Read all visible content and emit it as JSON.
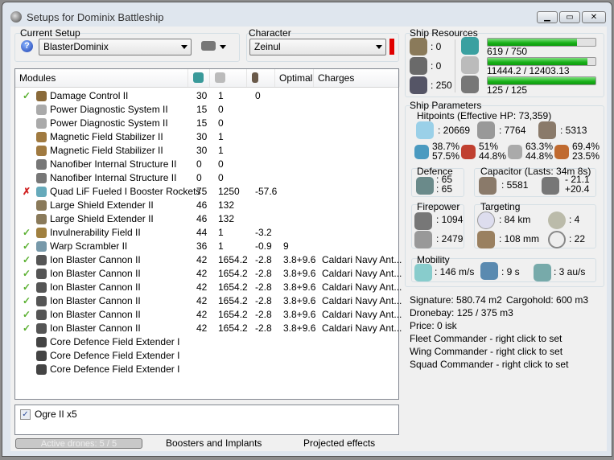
{
  "window": {
    "title": "Setups for Dominix Battleship"
  },
  "setup": {
    "label": "Current Setup",
    "value": "BlasterDominix"
  },
  "character": {
    "label": "Character",
    "value": "Zeinul",
    "status_color": "#e00000"
  },
  "modules": {
    "headers": [
      "Modules",
      "cpu-icon",
      "powergrid-icon",
      "capacitor-icon",
      "Optimal",
      "Charges"
    ],
    "rows": [
      {
        "status": "active",
        "name": "Damage Control II",
        "cpu": "30",
        "pg": "1",
        "cap": "0",
        "optimal": "",
        "charges": ""
      },
      {
        "status": "",
        "name": "Power Diagnostic System II",
        "cpu": "15",
        "pg": "0",
        "cap": "",
        "optimal": "",
        "charges": ""
      },
      {
        "status": "",
        "name": "Power Diagnostic System II",
        "cpu": "15",
        "pg": "0",
        "cap": "",
        "optimal": "",
        "charges": ""
      },
      {
        "status": "",
        "name": "Magnetic Field Stabilizer II",
        "cpu": "30",
        "pg": "1",
        "cap": "",
        "optimal": "",
        "charges": ""
      },
      {
        "status": "",
        "name": "Magnetic Field Stabilizer II",
        "cpu": "30",
        "pg": "1",
        "cap": "",
        "optimal": "",
        "charges": ""
      },
      {
        "status": "",
        "name": "Nanofiber Internal Structure II",
        "cpu": "0",
        "pg": "0",
        "cap": "",
        "optimal": "",
        "charges": ""
      },
      {
        "status": "",
        "name": "Nanofiber Internal Structure II",
        "cpu": "0",
        "pg": "0",
        "cap": "",
        "optimal": "",
        "charges": ""
      },
      {
        "status": "offline",
        "name": "Quad LiF Fueled I Booster Rockets",
        "cpu": "75",
        "pg": "1250",
        "cap": "-57.6",
        "optimal": "",
        "charges": ""
      },
      {
        "status": "",
        "name": "Large Shield Extender II",
        "cpu": "46",
        "pg": "132",
        "cap": "",
        "optimal": "",
        "charges": ""
      },
      {
        "status": "",
        "name": "Large Shield Extender II",
        "cpu": "46",
        "pg": "132",
        "cap": "",
        "optimal": "",
        "charges": ""
      },
      {
        "status": "active",
        "name": "Invulnerability Field II",
        "cpu": "44",
        "pg": "1",
        "cap": "-3.2",
        "optimal": "",
        "charges": ""
      },
      {
        "status": "active",
        "name": "Warp Scrambler II",
        "cpu": "36",
        "pg": "1",
        "cap": "-0.9",
        "optimal": "9",
        "charges": ""
      },
      {
        "status": "active",
        "name": "Ion Blaster Cannon II",
        "cpu": "42",
        "pg": "1654.2",
        "cap": "-2.8",
        "optimal": "3.8+9.6",
        "charges": "Caldari Navy Ant..."
      },
      {
        "status": "active",
        "name": "Ion Blaster Cannon II",
        "cpu": "42",
        "pg": "1654.2",
        "cap": "-2.8",
        "optimal": "3.8+9.6",
        "charges": "Caldari Navy Ant..."
      },
      {
        "status": "active",
        "name": "Ion Blaster Cannon II",
        "cpu": "42",
        "pg": "1654.2",
        "cap": "-2.8",
        "optimal": "3.8+9.6",
        "charges": "Caldari Navy Ant..."
      },
      {
        "status": "active",
        "name": "Ion Blaster Cannon II",
        "cpu": "42",
        "pg": "1654.2",
        "cap": "-2.8",
        "optimal": "3.8+9.6",
        "charges": "Caldari Navy Ant..."
      },
      {
        "status": "active",
        "name": "Ion Blaster Cannon II",
        "cpu": "42",
        "pg": "1654.2",
        "cap": "-2.8",
        "optimal": "3.8+9.6",
        "charges": "Caldari Navy Ant..."
      },
      {
        "status": "active",
        "name": "Ion Blaster Cannon II",
        "cpu": "42",
        "pg": "1654.2",
        "cap": "-2.8",
        "optimal": "3.8+9.6",
        "charges": "Caldari Navy Ant..."
      },
      {
        "status": "",
        "name": "Core Defence Field Extender I",
        "cpu": "",
        "pg": "",
        "cap": "",
        "optimal": "",
        "charges": ""
      },
      {
        "status": "",
        "name": "Core Defence Field Extender I",
        "cpu": "",
        "pg": "",
        "cap": "",
        "optimal": "",
        "charges": ""
      },
      {
        "status": "",
        "name": "Core Defence Field Extender I",
        "cpu": "",
        "pg": "",
        "cap": "",
        "optimal": "",
        "charges": ""
      }
    ]
  },
  "drones": {
    "item": "Ogre II x5",
    "checked": true
  },
  "bottom": {
    "active_drones": "Active drones: 5 / 5",
    "boosters": "Boosters and Implants",
    "projected": "Projected effects"
  },
  "resources": {
    "title": "Ship Resources",
    "turrets": ": 0",
    "launchers": ": 0",
    "drone_bw": ": 250",
    "cpu": {
      "text": "619 / 750",
      "fraction": 0.825
    },
    "pg": {
      "text": "11444.2 / 12403.13",
      "fraction": 0.923
    },
    "drone": {
      "text": "125 / 125",
      "fraction": 1.0
    }
  },
  "params": {
    "title": "Ship Parameters",
    "hp_title": "Hitpoints (Effective HP: 73,359)",
    "shield": ": 20669",
    "armor": ": 7764",
    "structure": ": 5313",
    "resists": [
      [
        "38.7%",
        "57.5%"
      ],
      [
        "51%",
        "44.8%"
      ],
      [
        "63.3%",
        "44.8%"
      ],
      [
        "69.4%",
        "23.5%"
      ]
    ],
    "defence_title": "Defence",
    "defence": [
      ": 65",
      ": 65"
    ],
    "cap_title": "Capacitor (Lasts: 34m 8s)",
    "cap": ": 5581",
    "cap_delta": [
      "- 21.1",
      "+20.4"
    ],
    "fire_title": "Firepower",
    "dps": ": 1094",
    "volley": ": 2479",
    "target_title": "Targeting",
    "range": ": 84 km",
    "max_targets": ": 4",
    "scan_res": ": 108 mm",
    "sensor": ": 22",
    "mob_title": "Mobility",
    "speed": ": 146 m/s",
    "align": ": 9 s",
    "warp": ": 3 au/s"
  },
  "info": {
    "signature": "Signature: 580.74 m2",
    "cargo": "Cargohold: 600 m3",
    "dronebay": "Dronebay: 125 / 375 m3",
    "price": "Price: 0 isk",
    "fleet": "Fleet Commander - right click to set",
    "wing": "Wing Commander - right click to set",
    "squad": "Squad Commander - right click to set"
  }
}
